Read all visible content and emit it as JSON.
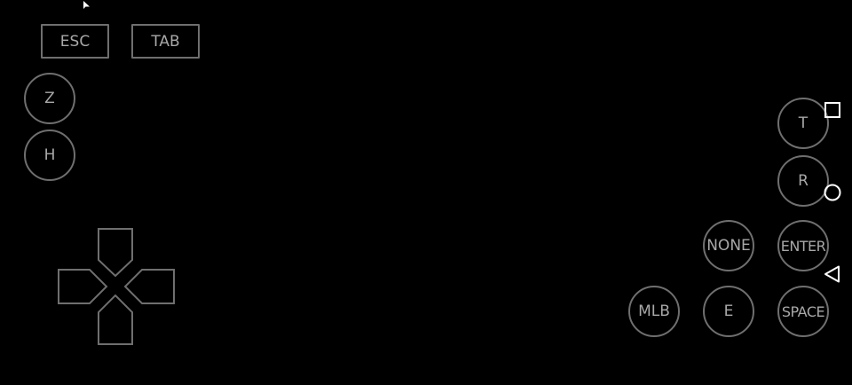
{
  "keys": {
    "esc": "ESC",
    "tab": "TAB",
    "z": "Z",
    "h": "H",
    "t": "T",
    "r": "R",
    "none": "NONE",
    "enter": "ENTER",
    "mlb": "MLB",
    "e": "E",
    "space": "SPACE"
  },
  "icons": {
    "cursor": "mouse-pointer-icon",
    "dpad": "dpad-icon",
    "recents": "square-recents-icon",
    "home": "circle-home-icon",
    "back": "triangle-back-icon"
  },
  "colors": {
    "background": "#000000",
    "outline": "#6f6f6f",
    "label": "#a8a8a8",
    "nav": "#ffffff"
  }
}
